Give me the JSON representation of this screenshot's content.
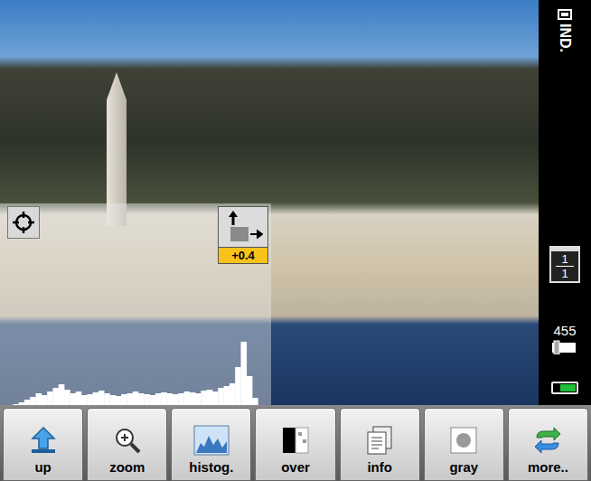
{
  "viewer": {
    "exposure": {
      "reading": "+0.4"
    }
  },
  "histogram": {
    "values": [
      0,
      1,
      3,
      6,
      9,
      13,
      11,
      15,
      19,
      23,
      17,
      13,
      15,
      11,
      12,
      14,
      16,
      13,
      11,
      10,
      12,
      13,
      15,
      13,
      12,
      11,
      13,
      14,
      13,
      12,
      13,
      15,
      14,
      13,
      16,
      17,
      15,
      19,
      21,
      24,
      42,
      70,
      32,
      8,
      0,
      0
    ]
  },
  "sidebar": {
    "mode": "IND.",
    "folder": {
      "current": "1",
      "total": "1"
    },
    "count": "455",
    "battery": {
      "level": 0.72
    }
  },
  "toolbar": {
    "buttons": [
      {
        "label": "up"
      },
      {
        "label": "zoom"
      },
      {
        "label": "histog."
      },
      {
        "label": "over"
      },
      {
        "label": "info"
      },
      {
        "label": "gray"
      },
      {
        "label": "more.."
      }
    ]
  }
}
